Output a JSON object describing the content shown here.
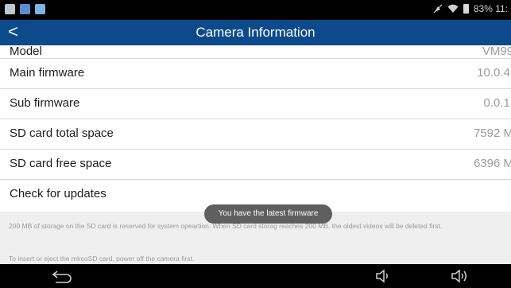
{
  "status_bar": {
    "icons": [
      "screen-icon",
      "gallery-icon",
      "photo-icon"
    ],
    "battery_text": "83% 11:"
  },
  "header": {
    "title": "Camera Information",
    "back_label": "<"
  },
  "info_rows": [
    {
      "label": "Model",
      "value": "VM99"
    },
    {
      "label": "Main firmware",
      "value": "10.0.4."
    },
    {
      "label": "Sub firmware",
      "value": "0.0.1."
    },
    {
      "label": "SD card total space",
      "value": "7592 M"
    },
    {
      "label": "SD card free space",
      "value": "6396 M"
    },
    {
      "label": "Check for updates",
      "value": ""
    }
  ],
  "notes": {
    "storage": "200 MB of storage on the SD card is reserved for system opeartion. When SD card storag reaches 200 MB, the oldest videos will be deleted first.",
    "sd_card": "To insert or eject the mircoSD card, power off the camera first."
  },
  "toast": "You have the latest firmware",
  "colors": {
    "header_bg": "#0d4a8b",
    "value_text": "#9b9b9b",
    "footer_bg": "#efefef",
    "toast_bg": "#5f5f5f"
  }
}
